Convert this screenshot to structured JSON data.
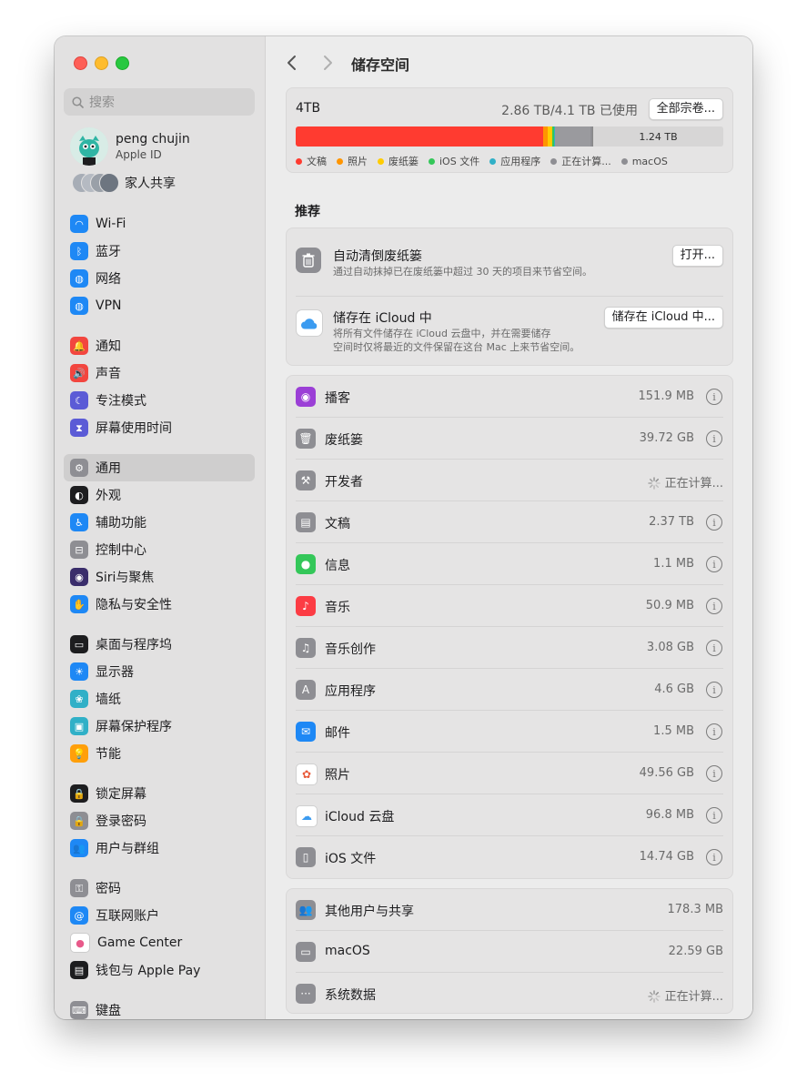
{
  "colors": {
    "docs": "#ff3b30",
    "photos": "#ff9500",
    "trash": "#ffcc00",
    "ios_files": "#34c759",
    "apps": "#30b0c7",
    "calculating": "#8e8e93",
    "macos": "#8e8e93"
  },
  "sidebar": {
    "search_placeholder": "搜索",
    "profile": {
      "name": "peng chujin",
      "subtitle": "Apple ID"
    },
    "family_label": "家人共享",
    "items": [
      {
        "label": "Wi-Fi",
        "icon": "wifi-icon",
        "color": "#1e88f5"
      },
      {
        "label": "蓝牙",
        "icon": "bluetooth-icon",
        "color": "#1e88f5"
      },
      {
        "label": "网络",
        "icon": "globe-icon",
        "color": "#1e88f5"
      },
      {
        "label": "VPN",
        "icon": "vpn-globe-icon",
        "color": "#1e88f5"
      },
      {
        "label": "通知",
        "icon": "bell-icon",
        "color": "#f2463f"
      },
      {
        "label": "声音",
        "icon": "speaker-icon",
        "color": "#f2463f"
      },
      {
        "label": "专注模式",
        "icon": "moon-icon",
        "color": "#5b5bd6"
      },
      {
        "label": "屏幕使用时间",
        "icon": "hourglass-icon",
        "color": "#5b5bd6"
      },
      {
        "label": "通用",
        "icon": "gear-icon",
        "color": "#8e8e93"
      },
      {
        "label": "外观",
        "icon": "appearance-icon",
        "color": "#1d1d1f"
      },
      {
        "label": "辅助功能",
        "icon": "accessibility-icon",
        "color": "#1e88f5"
      },
      {
        "label": "控制中心",
        "icon": "toggles-icon",
        "color": "#8e8e93"
      },
      {
        "label": "Siri与聚焦",
        "icon": "siri-icon",
        "color": "#3a2d6b"
      },
      {
        "label": "隐私与安全性",
        "icon": "hand-icon",
        "color": "#1e88f5"
      },
      {
        "label": "桌面与程序坞",
        "icon": "dock-icon",
        "color": "#1d1d1f"
      },
      {
        "label": "显示器",
        "icon": "sun-icon",
        "color": "#1e88f5"
      },
      {
        "label": "墙纸",
        "icon": "flower-icon",
        "color": "#30b0c7"
      },
      {
        "label": "屏幕保护程序",
        "icon": "screensaver-icon",
        "color": "#30b0c7"
      },
      {
        "label": "节能",
        "icon": "lightbulb-icon",
        "color": "#ff9f0a"
      },
      {
        "label": "锁定屏幕",
        "icon": "lock-icon",
        "color": "#1d1d1f"
      },
      {
        "label": "登录密码",
        "icon": "lock-icon",
        "color": "#8e8e93"
      },
      {
        "label": "用户与群组",
        "icon": "users-icon",
        "color": "#1e88f5"
      },
      {
        "label": "密码",
        "icon": "key-icon",
        "color": "#8e8e93"
      },
      {
        "label": "互联网账户",
        "icon": "at-icon",
        "color": "#1e88f5"
      },
      {
        "label": "Game Center",
        "icon": "game-center-icon",
        "color": "#ffffff"
      },
      {
        "label": "钱包与 Apple Pay",
        "icon": "wallet-icon",
        "color": "#1d1d1f"
      },
      {
        "label": "键盘",
        "icon": "keyboard-icon",
        "color": "#8e8e93"
      }
    ]
  },
  "toolbar": {
    "back": "‹",
    "forward": "›",
    "title": "储存空间"
  },
  "storage": {
    "total": "4TB",
    "used": "2.86 TB/4.1 TB 已使用",
    "button": "全部宗卷...",
    "free_label": "1.24 TB",
    "segments": [
      {
        "key": "docs",
        "fraction": 0.578
      },
      {
        "key": "photos",
        "fraction": 0.012
      },
      {
        "key": "trash",
        "fraction": 0.01
      },
      {
        "key": "ios_files",
        "fraction": 0.004
      },
      {
        "key": "apps",
        "fraction": 0.002
      },
      {
        "key": "calculating",
        "fraction": 0.083
      },
      {
        "key": "macos",
        "fraction": 0.005
      }
    ],
    "legend": [
      {
        "key": "docs",
        "label": "文稿"
      },
      {
        "key": "photos",
        "label": "照片"
      },
      {
        "key": "trash",
        "label": "废纸篓"
      },
      {
        "key": "ios_files",
        "label": "iOS 文件"
      },
      {
        "key": "apps",
        "label": "应用程序"
      },
      {
        "key": "calculating",
        "label": "正在计算..."
      },
      {
        "key": "macos",
        "label": "macOS"
      }
    ]
  },
  "recommend": {
    "heading": "推荐",
    "items": [
      {
        "title": "自动清倒废纸篓",
        "desc": "通过自动抹掉已在废纸篓中超过 30 天的项目来节省空间。",
        "button": "打开..."
      },
      {
        "title": "储存在 iCloud 中",
        "desc_line1": "将所有文件储存在 iCloud 云盘中，并在需要储存",
        "desc_line2": "空间时仅将最近的文件保留在这台 Mac 上来节省空间。",
        "button": "储存在 iCloud 中..."
      }
    ]
  },
  "categories": [
    {
      "label": "播客",
      "value": "151.9 MB",
      "icon": "podcast-icon",
      "color": "#9b3fd6",
      "glyph": "◉"
    },
    {
      "label": "废纸篓",
      "value": "39.72 GB",
      "icon": "trash-icon",
      "color": "#8e8e93",
      "glyph": "🗑"
    },
    {
      "label": "开发者",
      "value": "正在计算...",
      "icon": "hammer-icon",
      "color": "#8e8e93",
      "glyph": "⚒",
      "calculating": true
    },
    {
      "label": "文稿",
      "value": "2.37 TB",
      "icon": "document-icon",
      "color": "#8e8e93",
      "glyph": "▤"
    },
    {
      "label": "信息",
      "value": "1.1 MB",
      "icon": "messages-icon",
      "color": "#34c759",
      "glyph": "●"
    },
    {
      "label": "音乐",
      "value": "50.9 MB",
      "icon": "music-icon",
      "color": "#fc3c44",
      "glyph": "♪"
    },
    {
      "label": "音乐创作",
      "value": "3.08 GB",
      "icon": "music-creation-icon",
      "color": "#8e8e93",
      "glyph": "♫"
    },
    {
      "label": "应用程序",
      "value": "4.6 GB",
      "icon": "app-store-icon",
      "color": "#8e8e93",
      "glyph": "A"
    },
    {
      "label": "邮件",
      "value": "1.5 MB",
      "icon": "mail-icon",
      "color": "#1e88f5",
      "glyph": "✉"
    },
    {
      "label": "照片",
      "value": "49.56 GB",
      "icon": "photos-icon",
      "color": "#ffffff",
      "glyph": "✿"
    },
    {
      "label": "iCloud 云盘",
      "value": "96.8 MB",
      "icon": "icloud-icon",
      "color": "#ffffff",
      "glyph": "☁"
    },
    {
      "label": "iOS 文件",
      "value": "14.74 GB",
      "icon": "iphone-icon",
      "color": "#8e8e93",
      "glyph": "▯"
    }
  ],
  "system": [
    {
      "label": "其他用户与共享",
      "value": "178.3 MB",
      "icon": "shared-users-icon",
      "color": "#8e8e93",
      "glyph": "👥"
    },
    {
      "label": "macOS",
      "value": "22.59 GB",
      "icon": "drive-icon",
      "color": "#8e8e93",
      "glyph": "▭"
    },
    {
      "label": "系统数据",
      "value": "正在计算...",
      "icon": "more-icon",
      "color": "#8e8e93",
      "glyph": "···",
      "calculating": true
    }
  ]
}
